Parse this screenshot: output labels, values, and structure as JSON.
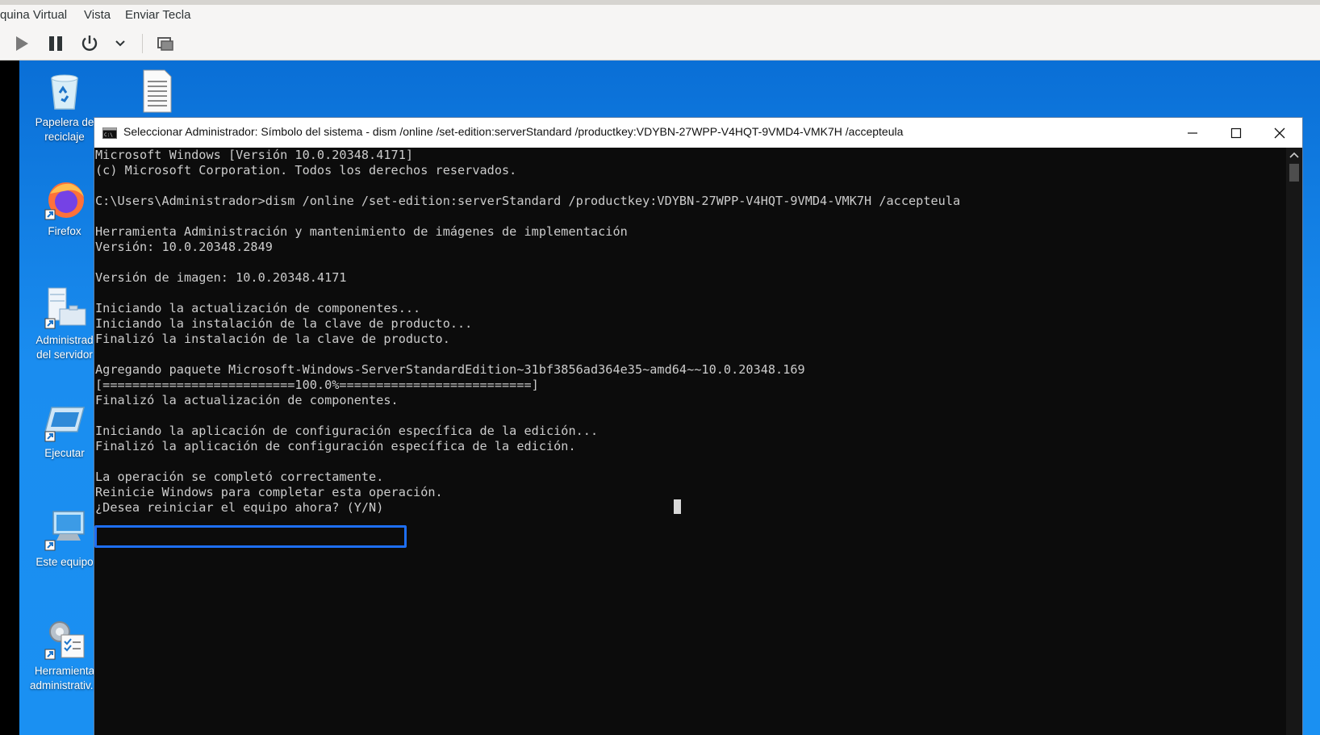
{
  "menubar": {
    "items": [
      "quina Virtual",
      "Vista",
      "Enviar Tecla"
    ]
  },
  "toolbar": {
    "icons": [
      "play-icon",
      "pause-icon",
      "power-icon",
      "chevron-down-icon",
      "screenshot-icon"
    ]
  },
  "desktop": {
    "icons": [
      {
        "label": "Papelera de\nreciclaje",
        "icon": "recycle-bin-icon"
      },
      {
        "label": "",
        "icon": "text-file-icon"
      },
      {
        "label": "Firefox",
        "icon": "firefox-icon"
      },
      {
        "label": "Administrad\ndel servidor",
        "icon": "server-manager-icon"
      },
      {
        "label": "Ejecutar",
        "icon": "run-icon"
      },
      {
        "label": "Este equipo",
        "icon": "this-pc-icon"
      },
      {
        "label": "Herramienta\nadministrativ...",
        "icon": "admin-tools-icon"
      }
    ]
  },
  "cmd_window": {
    "title": "Seleccionar Administrador: Símbolo del sistema - dism  /online /set-edition:serverStandard /productkey:VDYBN-27WPP-V4HQT-9VMD4-VMK7H /accepteula",
    "lines": [
      "Microsoft Windows [Versión 10.0.20348.4171]",
      "(c) Microsoft Corporation. Todos los derechos reservados.",
      "",
      "C:\\Users\\Administrador>dism /online /set-edition:serverStandard /productkey:VDYBN-27WPP-V4HQT-9VMD4-VMK7H /accepteula",
      "",
      "Herramienta Administración y mantenimiento de imágenes de implementación",
      "Versión: 10.0.20348.2849",
      "",
      "Versión de imagen: 10.0.20348.4171",
      "",
      "Iniciando la actualización de componentes...",
      "Iniciando la instalación de la clave de producto...",
      "Finalizó la instalación de la clave de producto.",
      "",
      "Agregando paquete Microsoft-Windows-ServerStandardEdition~31bf3856ad364e35~amd64~~10.0.20348.169",
      "[==========================100.0%==========================]",
      "Finalizó la actualización de componentes.",
      "",
      "Iniciando la aplicación de configuración específica de la edición...",
      "Finalizó la aplicación de configuración específica de la edición.",
      "",
      "La operación se completó correctamente.",
      "Reinicie Windows para completar esta operación.",
      "¿Desea reiniciar el equipo ahora? (Y/N)"
    ],
    "highlight_color": "#1e6ff5"
  },
  "colors": {
    "desktop_blue": "#1a8df0",
    "console_bg": "#0c0c0c",
    "console_text": "#cccccc"
  }
}
